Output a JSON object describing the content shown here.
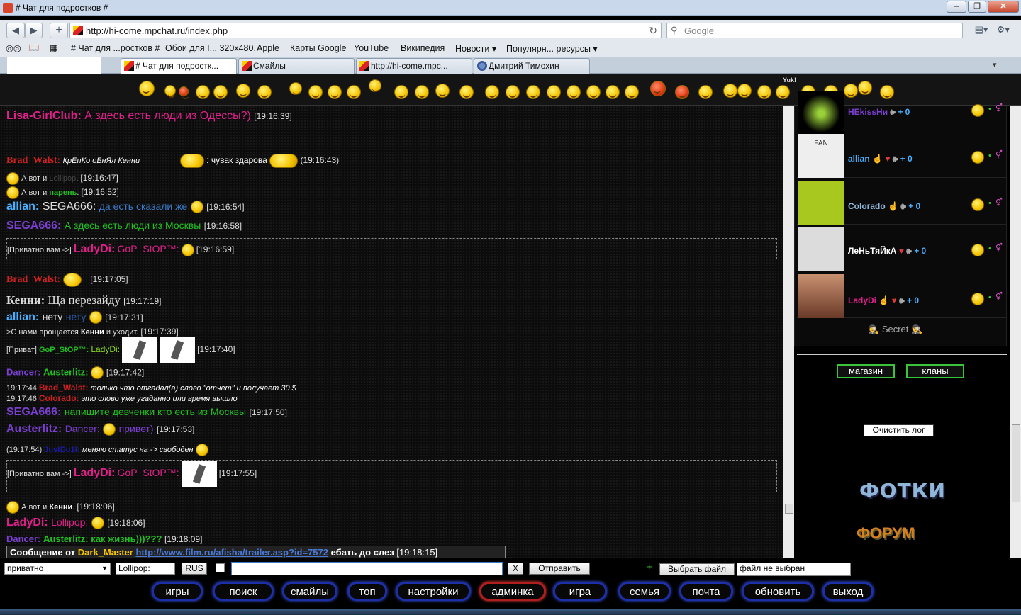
{
  "window": {
    "title": "# Чат для подростков #"
  },
  "nav": {
    "url": "http://hi-come.mpchat.ru/index.php",
    "search_placeholder": "Google"
  },
  "bookmarks": [
    "# Чат для ...ростков #",
    "Обои для I... 320x480.",
    "Apple",
    "Карты Google",
    "YouTube",
    "Википедия",
    "Новости ▾",
    "Популярн... ресурсы ▾"
  ],
  "tabs": [
    {
      "label": "# Чат для подростк...",
      "active": true
    },
    {
      "label": "Смайлы",
      "active": false
    },
    {
      "label": "http://hi-come.mpc...",
      "active": false
    },
    {
      "label": "Дмитрий Тимохин",
      "active": false
    }
  ],
  "smile_bar": {
    "yuk_label": "Yuk!"
  },
  "chat": {
    "l1": {
      "nick": "Lisa-GirlClub:",
      "text": "А здесь есть люди из Одессы?)",
      "time": "[19:16:39]"
    },
    "l2": {
      "nick": "Brad_Walst:",
      "text": "КрЕпКо оБнЯл Кенни",
      "text2": ": чувак здарова",
      "time": "(19:16:43)"
    },
    "l3": {
      "a": "А вот и",
      "nick": "Lollipop",
      "dot": ".",
      "time": "[19:16:47]"
    },
    "l4": {
      "a": "А вот и",
      "nick": "парень",
      "dot": ".",
      "time": "[19:16:52]"
    },
    "l5": {
      "nick": "allian:",
      "to": "SEGA666:",
      "text": "да есть сказали же",
      "time": "[19:16:54]"
    },
    "l6": {
      "nick": "SEGA666:",
      "text": "А здесь есть люди из Москвы",
      "time": "[19:16:58]"
    },
    "p1": {
      "pre": "[Приватно вам ->]",
      "nick": "LadyDi:",
      "to": "GoP_StOP™:",
      "time": "[19:16:59]"
    },
    "l7": {
      "nick": "Brad_Walst:",
      "time": "[19:17:05]"
    },
    "l8": {
      "nick": "Кенни:",
      "text": "Ща перезайду",
      "time": "[19:17:19]"
    },
    "l9": {
      "nick": "allian:",
      "a": "нету",
      "b": "нету",
      "time": "[19:17:31]"
    },
    "l10": {
      "a": ">С нами прощается",
      "nick": "Кенни",
      "b": "и уходит.",
      "time": "[19:17:39]"
    },
    "l11": {
      "pre": "[Приват]",
      "nick": "GoP_StOP™:",
      "to": "LadyDi:",
      "time": "[19:17:40]"
    },
    "l12": {
      "nick": "Dancer:",
      "to": "Austerlitz:",
      "time": "[19:17:42]"
    },
    "l13": {
      "time": "19:17:44",
      "nick": "Brad_Walst:",
      "text": "только что отгадал(а) слово \"отчет\" и получает 30 $"
    },
    "l14": {
      "time": "19:17:46",
      "nick": "Colorado:",
      "text": "это слово уже угаданно или время вышло"
    },
    "l15": {
      "nick": "SEGA666:",
      "text": "напишите девченки кто есть из Москвы",
      "time": "[19:17:50]"
    },
    "l16": {
      "nick": "Austerlitz:",
      "to": "Dancer:",
      "text": "привет)",
      "time": "[19:17:53]"
    },
    "l17": {
      "time": "(19:17:54)",
      "nick": "JustDo1t:",
      "text": "меняю статус на -> свободен"
    },
    "p2": {
      "pre": "[Приватно вам ->]",
      "nick": "LadyDi:",
      "to": "GoP_StOP™:",
      "time": "[19:17:55]"
    },
    "l18": {
      "a": "А вот и",
      "nick": "Кенни",
      "dot": ".",
      "time": "[19:18:06]"
    },
    "l19": {
      "nick": "LadyDi:",
      "to": "Lollipop:",
      "time": "[19:18:06]"
    },
    "l20": {
      "nick": "Dancer:",
      "to": "Austerlitz:",
      "text": "как жизнь)))???",
      "time": "[19:18:09]"
    },
    "msg": {
      "pre": "Сообщение от",
      "nick": "Dark_Master",
      "link": "http://www.film.ru/afisha/trailer.asp?id=7572",
      "text": "ебать до слез",
      "time": "[19:18:15]"
    }
  },
  "users": [
    {
      "name": "HEkissHи",
      "tail": "+ 0",
      "color": "#7a3fd0"
    },
    {
      "name": "allian",
      "tail": "+ 0",
      "color": "#4ab0ff",
      "avatar_text": "FAN"
    },
    {
      "name": "Colorado",
      "tail": "+ 0",
      "color": "#8fb6d9"
    },
    {
      "name": "ЛеНьТяЙкА",
      "tail": "+ 0",
      "color": "#ffffff"
    },
    {
      "name": "LadyDi",
      "tail": "+ 0",
      "color": "#e0208a"
    }
  ],
  "side": {
    "secret": "Secret",
    "shop": "магазин",
    "clans": "кланы",
    "clear_log": "Очистить лог",
    "photos": "ФОТКИ",
    "forum": "ФОРУМ"
  },
  "input": {
    "mode": "приватно",
    "to": "Lollipop:",
    "lang": "RUS",
    "x": "X",
    "send": "Отправить",
    "plus": "+",
    "choose": "Выбрать файл",
    "nofile": "файл не выбран"
  },
  "menu": [
    "игры",
    "поиск",
    "смайлы",
    "топ",
    "настройки",
    "админка",
    "игра",
    "семья",
    "почта",
    "обновить",
    "выход"
  ]
}
